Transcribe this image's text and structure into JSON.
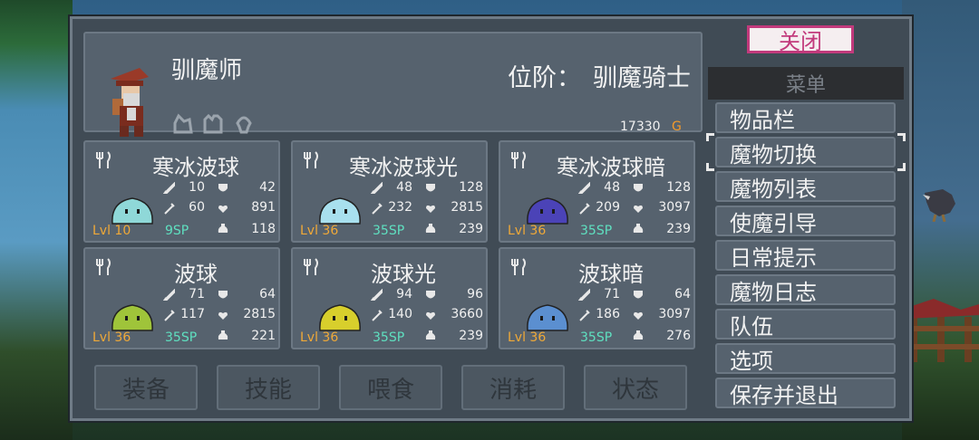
{
  "header": {
    "name": "驯魔师",
    "rank_label": "位阶：",
    "rank_value": "驯魔骑士",
    "gold_amount": "17330",
    "gold_symbol": "G"
  },
  "close_label": "关闭",
  "menu": {
    "title": "菜单",
    "items": [
      "物品栏",
      "魔物切换",
      "魔物列表",
      "使魔引导",
      "日常提示",
      "魔物日志",
      "队伍",
      "选项",
      "保存并退出"
    ],
    "selected_index": 1
  },
  "tabs": [
    "装备",
    "技能",
    "喂食",
    "消耗",
    "状态"
  ],
  "monsters": [
    {
      "name": "寒冰波球",
      "lvl": "Lvl 10",
      "sp": "9SP",
      "atk": "10",
      "def": "42",
      "matk": "60",
      "hp": "891",
      "mana": "118",
      "color": "#8fd8d8"
    },
    {
      "name": "寒冰波球光",
      "lvl": "Lvl 36",
      "sp": "35SP",
      "atk": "48",
      "def": "128",
      "matk": "232",
      "hp": "2815",
      "mana": "239",
      "color": "#a8e0ee"
    },
    {
      "name": "寒冰波球暗",
      "lvl": "Lvl 36",
      "sp": "35SP",
      "atk": "48",
      "def": "128",
      "matk": "209",
      "hp": "3097",
      "mana": "239",
      "color": "#4b43b7"
    },
    {
      "name": "波球",
      "lvl": "Lvl 36",
      "sp": "35SP",
      "atk": "71",
      "def": "64",
      "matk": "117",
      "hp": "2815",
      "mana": "221",
      "color": "#9fc43a"
    },
    {
      "name": "波球光",
      "lvl": "Lvl 36",
      "sp": "35SP",
      "atk": "94",
      "def": "96",
      "matk": "140",
      "hp": "3660",
      "mana": "239",
      "color": "#d8cf2c"
    },
    {
      "name": "波球暗",
      "lvl": "Lvl 36",
      "sp": "35SP",
      "atk": "71",
      "def": "64",
      "matk": "186",
      "hp": "3097",
      "mana": "276",
      "color": "#5b8fd0"
    }
  ]
}
